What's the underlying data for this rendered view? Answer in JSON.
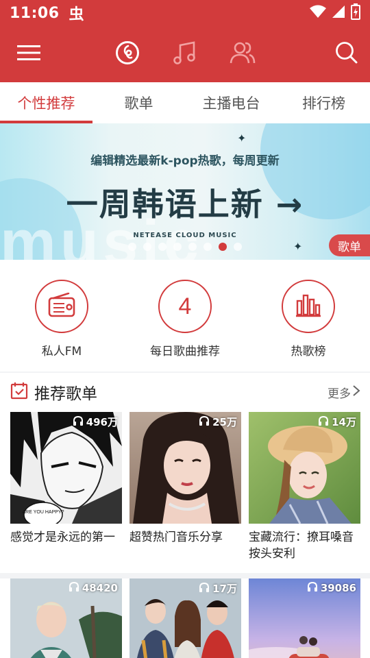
{
  "status": {
    "time": "11:06",
    "bug_glyph": "虫"
  },
  "tabs": [
    {
      "label": "个性推荐"
    },
    {
      "label": "歌单"
    },
    {
      "label": "主播电台"
    },
    {
      "label": "排行榜"
    }
  ],
  "banner": {
    "subtitle": "编辑精选最新k-pop热歌，每周更新",
    "headline": "一周韩语上新 →",
    "brand": "NETEASE CLOUD MUSIC",
    "bg_word": "music",
    "badge": "歌单",
    "page_count": 8,
    "active_page": 7
  },
  "quick": {
    "fm": {
      "label": "私人FM"
    },
    "daily": {
      "label": "每日歌曲推荐",
      "day": "4"
    },
    "rank": {
      "label": "热歌榜"
    }
  },
  "recommend": {
    "title": "推荐歌单",
    "more": "更多",
    "playlists": [
      {
        "count": "496万",
        "title": "感觉才是永远的第一",
        "bubble": "ARE YOU HAPPY?"
      },
      {
        "count": "25万",
        "title": "超赞热门音乐分享"
      },
      {
        "count": "14万",
        "title": "宝藏流行：撩耳嗓音按头安利"
      },
      {
        "count": "48420",
        "title": ""
      },
      {
        "count": "17万",
        "title": ""
      },
      {
        "count": "39086",
        "title": ""
      }
    ]
  },
  "colors": {
    "brand_red": "#d23b3c"
  }
}
